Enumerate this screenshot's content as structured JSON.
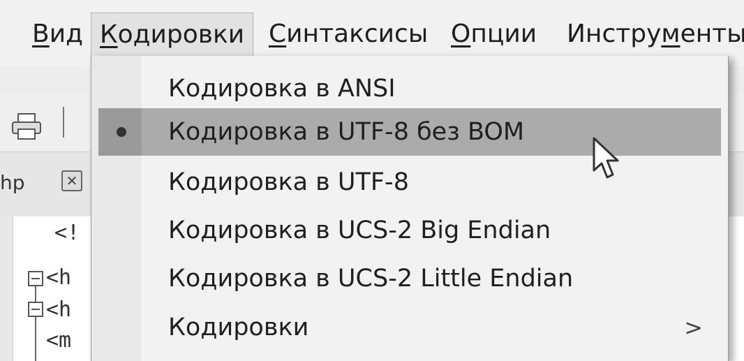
{
  "menubar": {
    "items": [
      {
        "accel": "В",
        "rest": "ид"
      },
      {
        "accel": "К",
        "rest": "одировки"
      },
      {
        "accel": "С",
        "rest": "интаксисы"
      },
      {
        "accel": "О",
        "rest": "пции"
      },
      {
        "pre": "Инстру",
        "accel": "м",
        "rest": "енты"
      }
    ]
  },
  "editor": {
    "tab_label": "hp",
    "code_lines": [
      "<!",
      "<h",
      "<h",
      "<m"
    ]
  },
  "encoding_menu": {
    "items": [
      {
        "label": "Кодировка в ANSI"
      },
      {
        "label": "Кодировка в UTF-8 без BOM",
        "checked": true
      },
      {
        "label": "Кодировка в UTF-8"
      },
      {
        "label": "Кодировка в UCS-2 Big Endian"
      },
      {
        "label": "Кодировка в UCS-2 Little Endian"
      },
      {
        "label": "Кодировки",
        "submenu_arrow": ">"
      }
    ]
  },
  "icons": [
    "printer-icon",
    "mouse-pointer-icon",
    "close-icon",
    "radio-dot-icon",
    "submenu-arrow-icon",
    "fold-minus-icon"
  ],
  "colors": {
    "menu_bg": "#f2f2f2",
    "highlight": "#ababab"
  }
}
